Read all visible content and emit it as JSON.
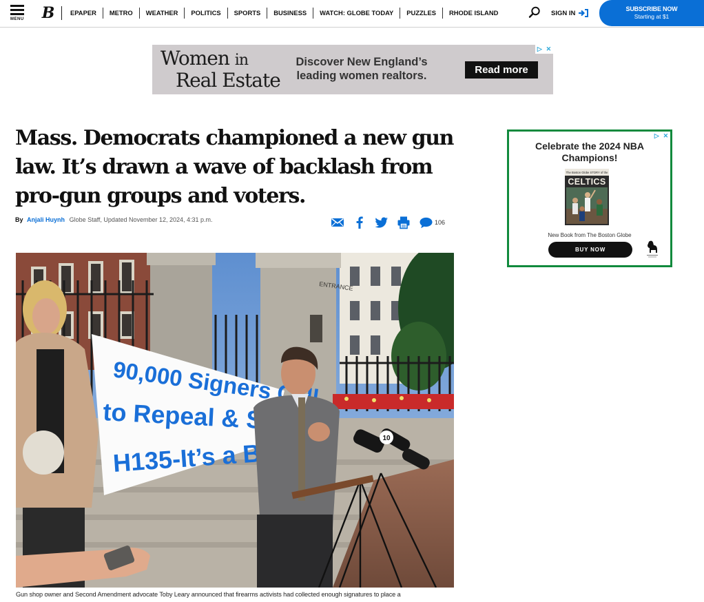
{
  "nav": {
    "menu_label": "MENU",
    "logo": "B",
    "items": [
      "EPAPER",
      "METRO",
      "WEATHER",
      "POLITICS",
      "SPORTS",
      "BUSINESS",
      "WATCH: GLOBE TODAY",
      "PUZZLES",
      "RHODE ISLAND"
    ],
    "signin": "SIGN IN",
    "subscribe_line1": "SUBSCRIBE NOW",
    "subscribe_line2": "Starting at $1"
  },
  "top_ad": {
    "brand_women": "Women",
    "brand_in": "in",
    "brand_real_estate": "Real Estate",
    "copy": "Discover New England’s leading women realtors.",
    "cta": "Read more"
  },
  "article": {
    "headline": "Mass. Democrats championed a new gun law. It’s drawn a wave of backlash from pro-gun groups and voters.",
    "by": "By",
    "author": "Anjali Huynh",
    "meta": "Globe Staff, Updated November 12, 2024, 4:31 p.m.",
    "comment_count": "106",
    "caption": "Gun shop owner and Second Amendment advocate Toby Leary announced that firearms activists had collected enough signatures to place a"
  },
  "photo": {
    "sign_line1": "90,000 Signers Call",
    "sign_line2": "to Repeal & Sus",
    "sign_line3": "H135-It’s a Bad",
    "entrance_label": "ENTRANCE",
    "mic_label": "10"
  },
  "side_ad": {
    "headline": "Celebrate the 2024 NBA Champions!",
    "book_title": "CELTICS",
    "book_top": "The Boston Globe STORY of the",
    "subtext": "New Book from The Boston Globe",
    "cta": "BUY NOW"
  },
  "colors": {
    "accent": "#0a6fd6",
    "side_ad_border": "#118a3d",
    "sign_text": "#1a6fd8"
  },
  "icons": [
    "menu-icon",
    "search-icon",
    "signin-arrow-icon",
    "adchoices-icon",
    "email-icon",
    "facebook-icon",
    "twitter-icon",
    "print-icon",
    "comment-icon"
  ]
}
